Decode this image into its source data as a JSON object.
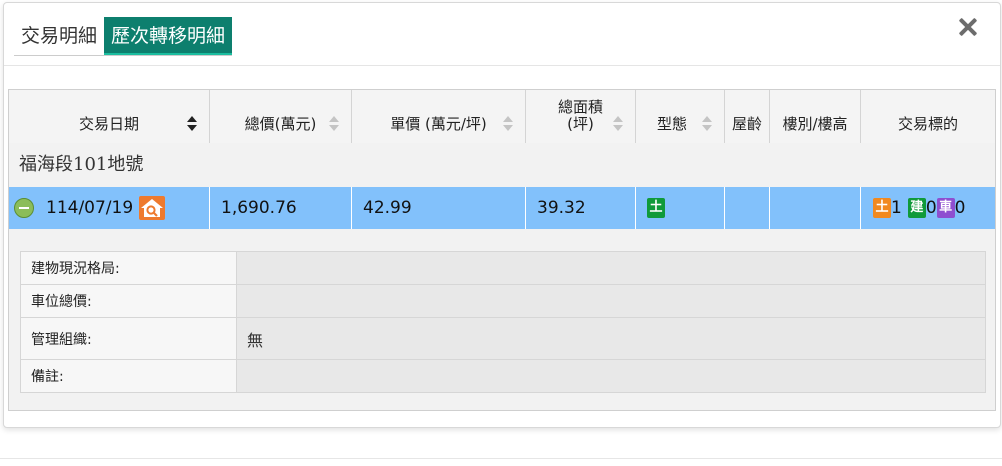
{
  "tabs": [
    {
      "label": "交易明細",
      "active": false
    },
    {
      "label": "歷次轉移明細",
      "active": true
    }
  ],
  "close_icon": "close-icon",
  "columns": [
    {
      "label": "交易日期",
      "sort": "active"
    },
    {
      "label": "總價(萬元)",
      "sort": "inactive"
    },
    {
      "label": "單價 (萬元/坪)",
      "sort": "inactive"
    },
    {
      "label": "總面積\n(坪)",
      "sort": "inactive"
    },
    {
      "label": "型態",
      "sort": "inactive"
    },
    {
      "label": "屋齡",
      "sort": "none"
    },
    {
      "label": "樓別/樓高",
      "sort": "none"
    },
    {
      "label": "交易標的",
      "sort": "none"
    }
  ],
  "group_label": "福海段101地號",
  "record": {
    "date": "114/07/19",
    "total_price": "1,690.76",
    "unit_price": "42.99",
    "area": "39.32",
    "type_tag": "土",
    "age": "",
    "floor": "",
    "targets": [
      {
        "tag": "土",
        "count": "1",
        "color": "#f1891f"
      },
      {
        "tag": "建",
        "count": "0",
        "color": "#109a3a"
      },
      {
        "tag": "車",
        "count": "0",
        "color": "#8e4fd0"
      }
    ]
  },
  "details": [
    {
      "label": "建物現況格局:",
      "value": ""
    },
    {
      "label": "車位總價:",
      "value": ""
    },
    {
      "label": "管理組織:",
      "value": "無"
    },
    {
      "label": "備註:",
      "value": ""
    }
  ],
  "accent_color": "#0d7f6e",
  "row_highlight_color": "#82c1fb"
}
